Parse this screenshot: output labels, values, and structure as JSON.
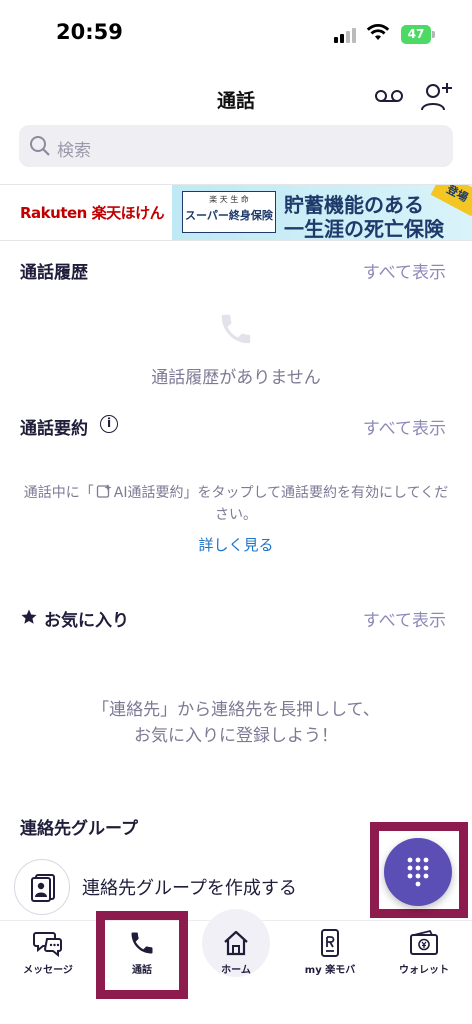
{
  "status_bar": {
    "time": "20:59",
    "battery": "47"
  },
  "header": {
    "title": "通話"
  },
  "search": {
    "placeholder": "検索"
  },
  "ad": {
    "brand": "Rakuten 楽天ほけん",
    "product_top": "楽 天 生 命",
    "product_name": "スーパー終身保険",
    "headline_1": "貯蓄機能のある",
    "headline_2": "一生涯の死亡保険",
    "corner": "登場"
  },
  "call_history": {
    "title": "通話履歴",
    "see_all": "すべて表示",
    "empty": "通話履歴がありません"
  },
  "call_summary": {
    "title": "通話要約",
    "see_all": "すべて表示",
    "hint_before": "通話中に「",
    "hint_after": "AI通話要約」をタップして通話要約を有効にしてください。",
    "learn_more": "詳しく見る"
  },
  "favorites": {
    "title": "お気に入り",
    "see_all": "すべて表示",
    "hint_line1": "「連絡先」から連絡先を長押しして、",
    "hint_line2": "お気に入りに登録しよう！"
  },
  "contact_groups": {
    "title": "連絡先グループ",
    "create": "連絡先グループを作成する"
  },
  "bottom_nav": {
    "messages": "メッセージ",
    "calls": "通話",
    "home": "ホーム",
    "my_rakuten": "my 楽モバ",
    "wallet": "ウォレット"
  },
  "colors": {
    "accent": "#5b4fb6",
    "highlight": "#8d1b4d",
    "link": "#1e74c9",
    "see_all": "#8e8ab8"
  }
}
